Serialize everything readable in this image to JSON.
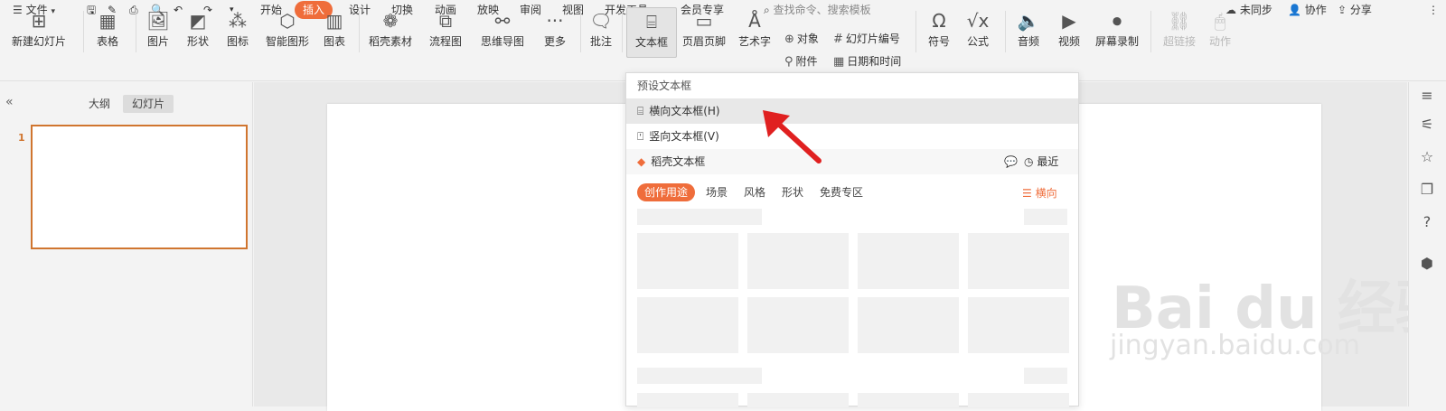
{
  "topbar": {
    "menu_label": "文件",
    "tabs": [
      "开始",
      "插入",
      "设计",
      "切换",
      "动画",
      "放映",
      "审阅",
      "视图",
      "开发工具",
      "会员专享"
    ],
    "search_placeholder": "查找命令、搜索模板",
    "sync_label": "未同步",
    "collab_label": "协作",
    "share_label": "分享"
  },
  "ribbon": {
    "new_slide": "新建幻灯片",
    "table": "表格",
    "picture": "图片",
    "shape": "形状",
    "icon": "图标",
    "smartart": "智能图形",
    "chart": "图表",
    "material": "稻壳素材",
    "flowchart": "流程图",
    "mindmap": "思维导图",
    "more": "更多",
    "comment": "批注",
    "textbox": "文本框",
    "header_footer": "页眉页脚",
    "wordart": "艺术字",
    "object": "对象",
    "attachment": "附件",
    "slide_number": "幻灯片编号",
    "datetime": "日期和时间",
    "symbol": "符号",
    "formula": "公式",
    "audio": "音频",
    "video": "视频",
    "screen_record": "屏幕录制",
    "hyperlink": "超链接",
    "action": "动作"
  },
  "leftpane": {
    "tab_outline": "大纲",
    "tab_slides": "幻灯片",
    "slide_number": "1"
  },
  "dropdown": {
    "section_title": "预设文本框",
    "horizontal": "横向文本框(H)",
    "vertical": "竖向文本框(V)",
    "daoke_title": "稻壳文本框",
    "recent": "最近",
    "categories": [
      "创作用途",
      "场景",
      "风格",
      "形状",
      "免费专区"
    ],
    "orientation": "横向"
  },
  "watermark": {
    "brand": "Bai du 经验",
    "url": "jingyan.baidu.com"
  },
  "colors": {
    "accent": "#ef6d3b",
    "selection_border": "#d0752f",
    "arrow": "#e02020"
  }
}
